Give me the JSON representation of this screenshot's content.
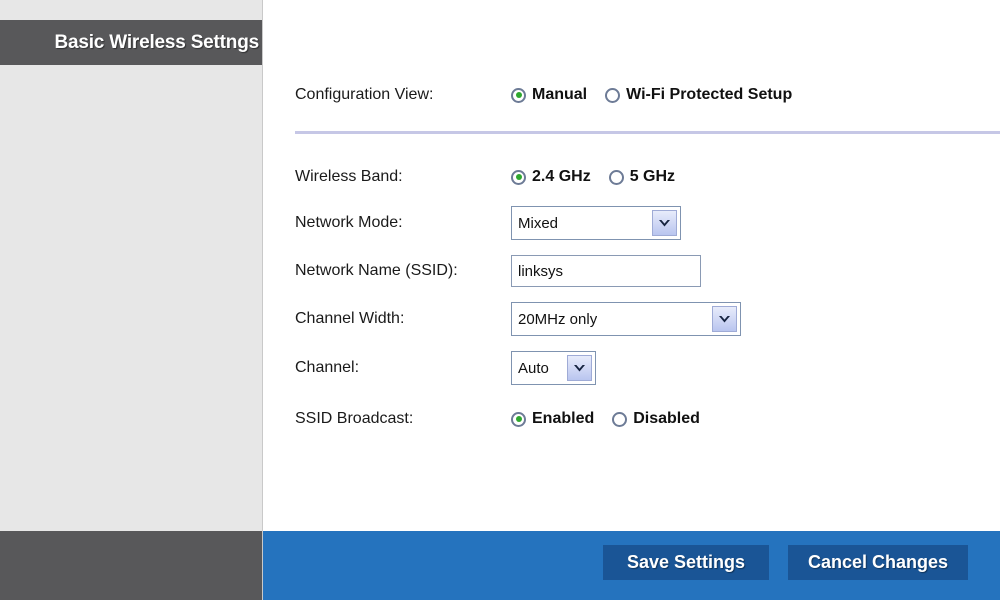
{
  "window": {
    "title": "Basic Wireless Settngs"
  },
  "form": {
    "configuration_view": {
      "label": "Configuration View:",
      "options": [
        {
          "label": "Manual",
          "selected": true
        },
        {
          "label": "Wi-Fi Protected Setup",
          "selected": false
        }
      ]
    },
    "wireless_band": {
      "label": "Wireless Band:",
      "options": [
        {
          "label": "2.4 GHz",
          "selected": true
        },
        {
          "label": "5 GHz",
          "selected": false
        }
      ]
    },
    "network_mode": {
      "label": "Network Mode:",
      "value": "Mixed"
    },
    "network_name": {
      "label": "Network Name (SSID):",
      "value": "linksys",
      "placeholder": ""
    },
    "channel_width": {
      "label": "Channel Width:",
      "value": "20MHz only"
    },
    "channel": {
      "label": "Channel:",
      "value": "Auto"
    },
    "ssid_broadcast": {
      "label": "SSID Broadcast:",
      "options": [
        {
          "label": "Enabled",
          "selected": true
        },
        {
          "label": "Disabled",
          "selected": false
        }
      ]
    }
  },
  "footer": {
    "save_label": "Save Settings",
    "cancel_label": "Cancel Changes"
  },
  "colors": {
    "title_bar": "#58585a",
    "panel_bg": "#ffffff",
    "left_bg": "#e7e7e7",
    "action_bar": "#2573be",
    "button": "#1a5596",
    "divider": "#c6c7e6",
    "radio_dot": "#2fa82f",
    "field_border": "#8a9ab4"
  }
}
